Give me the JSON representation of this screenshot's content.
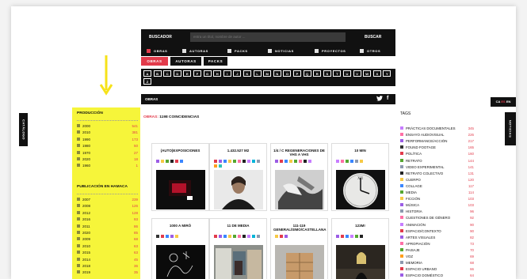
{
  "search": {
    "label": "BUSCADOR",
    "placeholder": "entra un títol, nombre de autor ...",
    "button": "BUSCAR"
  },
  "filters": [
    {
      "label": "OBRAS",
      "active": true
    },
    {
      "label": "AUTORAS",
      "active": false
    },
    {
      "label": "PACKS",
      "active": false
    },
    {
      "label": "NOTICIAS",
      "active": false
    },
    {
      "label": "PROYECTOS",
      "active": false
    },
    {
      "label": "OTROS",
      "active": false
    }
  ],
  "tabs": [
    {
      "label": "OBRAS",
      "active": true
    },
    {
      "label": "AUTORAS",
      "active": false
    },
    {
      "label": "PACKS",
      "active": false
    }
  ],
  "alphabet": [
    "A",
    "B",
    "C",
    "D",
    "E",
    "F",
    "G",
    "H",
    "I",
    "J",
    "K",
    "L",
    "M",
    "N",
    "O",
    "P",
    "Q",
    "R",
    "S",
    "T",
    "U",
    "V",
    "W",
    "X",
    "Y",
    "Z"
  ],
  "section": {
    "title": "OBRAS",
    "twitter_icon": "twitter-icon",
    "facebook_icon": "facebook-icon"
  },
  "results": {
    "prefix": "OBRAS:",
    "text": "1198 COINCIDENCIAS"
  },
  "side": {
    "catalogo": "CATÁLOGO",
    "noticias": "NOTICIAS"
  },
  "languages": {
    "ca": "CA",
    "es": "ES",
    "en": "EN"
  },
  "production": {
    "title": "PRODUCCIÓN",
    "items": [
      {
        "year": "2000",
        "count": "541"
      },
      {
        "year": "2010",
        "count": "381"
      },
      {
        "year": "1990",
        "count": "173"
      },
      {
        "year": "1980",
        "count": "50"
      },
      {
        "year": "1970",
        "count": "27"
      },
      {
        "year": "2020",
        "count": "18"
      },
      {
        "year": "1960",
        "count": "1"
      }
    ]
  },
  "publication": {
    "title": "PUBLICACIÓN EN HAMACA",
    "items": [
      {
        "year": "2007",
        "count": "239"
      },
      {
        "year": "2008",
        "count": "126"
      },
      {
        "year": "2012",
        "count": "128"
      },
      {
        "year": "2016",
        "count": "93"
      },
      {
        "year": "2011",
        "count": "86"
      },
      {
        "year": "2020",
        "count": "85"
      },
      {
        "year": "2009",
        "count": "68"
      },
      {
        "year": "2010",
        "count": "63"
      },
      {
        "year": "2015",
        "count": "63"
      },
      {
        "year": "2014",
        "count": "45"
      },
      {
        "year": "2018",
        "count": "36"
      },
      {
        "year": "2019",
        "count": "35"
      }
    ]
  },
  "cards": [
    {
      "title": "(AUTO)EXPOSICIONES",
      "colors": [
        "#9b5de5",
        "#f6c945",
        "#55a630",
        "#222",
        "#e23b4b",
        "#3a86ff"
      ],
      "thumb": "dark-red"
    },
    {
      "title": "1.432.527 M2",
      "colors": [
        "#e23b4b",
        "#9b5de5",
        "#3a86ff",
        "#f6c945",
        "#55a630",
        "#ff70a6",
        "#222",
        "#c77dff",
        "#00b4d8",
        "#8d99ae",
        "#ff9f1c",
        "#2ec4b6"
      ],
      "thumb": "portrait"
    },
    {
      "title": "1/4 / C REGENERACIONES DE VHS A VHS",
      "colors": [
        "#9b5de5",
        "#e23b4b",
        "#3a86ff",
        "#f6c945",
        "#55a630",
        "#ff70a6",
        "#222",
        "#c77dff"
      ],
      "thumb": "hands"
    },
    {
      "title": "10 MIN",
      "colors": [
        "#c77dff",
        "#ff70a6",
        "#55a630",
        "#3a86ff",
        "#8d99ae",
        "#f6c945"
      ],
      "thumb": "clock"
    },
    {
      "title": "1000 A MIRÓ",
      "colors": [
        "#333",
        "#e23b4b",
        "#3a86ff",
        "#9b5de5",
        "#f6c945"
      ],
      "thumb": "drawing"
    },
    {
      "title": "11 DE MEDIA",
      "colors": [
        "#e23b4b",
        "#9b5de5",
        "#3a86ff",
        "#f6c945",
        "#55a630",
        "#ff70a6",
        "#222",
        "#c77dff",
        "#00b4d8",
        "#8d99ae"
      ],
      "thumb": "room"
    },
    {
      "title": "111-119 GENERALÍSIMO/CASTELLANA",
      "colors": [
        "#f6c945",
        "#e23b4b",
        "#9b5de5"
      ],
      "thumb": "boxes"
    },
    {
      "title": "123M!",
      "colors": [
        "#9b5de5",
        "#e23b4b",
        "#3a86ff",
        "#c77dff",
        "#55a630",
        "#222"
      ],
      "thumb": "figure"
    }
  ],
  "tags": {
    "title": "TAGS",
    "items": [
      {
        "label": "PRÁCTICAS DOCUMENTALES",
        "count": "345",
        "color": "#c77dff"
      },
      {
        "label": "ENSAYO AUDIOVISUAL",
        "count": "226",
        "color": "#ff70a6"
      },
      {
        "label": "PERFORMANCE/ACCIÓN",
        "count": "217",
        "color": "#9b5de5"
      },
      {
        "label": "FOUND FOOTAGE",
        "count": "165",
        "color": "#333333"
      },
      {
        "label": "POLÍTICA",
        "count": "160",
        "color": "#e23b4b"
      },
      {
        "label": "RETRATO",
        "count": "144",
        "color": "#55a630"
      },
      {
        "label": "VIDEO EXPERIMENTAL",
        "count": "141",
        "color": "#8d99ae"
      },
      {
        "label": "RETRATO COLECTIVO",
        "count": "131",
        "color": "#222222"
      },
      {
        "label": "CUERPO",
        "count": "120",
        "color": "#f6c945"
      },
      {
        "label": "COLLAGE",
        "count": "117",
        "color": "#3a86ff"
      },
      {
        "label": "MEDIA",
        "count": "114",
        "color": "#55a630"
      },
      {
        "label": "FICCIÓN",
        "count": "103",
        "color": "#f6c945"
      },
      {
        "label": "MÚSICA",
        "count": "103",
        "color": "#9b5de5"
      },
      {
        "label": "HISTORIA",
        "count": "96",
        "color": "#8d99ae"
      },
      {
        "label": "CUESTIONES DE GÉNERO",
        "count": "92",
        "color": "#ff70a6"
      },
      {
        "label": "ANIMACIÓN",
        "count": "90",
        "color": "#c77dff"
      },
      {
        "label": "ESPACIO/CONTEXTO",
        "count": "90",
        "color": "#e23b4b"
      },
      {
        "label": "ARTES VISUALES",
        "count": "82",
        "color": "#9b5de5"
      },
      {
        "label": "APROPIACIÓN",
        "count": "73",
        "color": "#ff70a6"
      },
      {
        "label": "PAISAJE",
        "count": "70",
        "color": "#55a630"
      },
      {
        "label": "VOZ",
        "count": "69",
        "color": "#ff9f1c"
      },
      {
        "label": "MEMORIA",
        "count": "68",
        "color": "#8d99ae"
      },
      {
        "label": "ESPACIO URBANO",
        "count": "66",
        "color": "#e23b4b"
      },
      {
        "label": "ESPACIO DOMÉSTICO",
        "count": "64",
        "color": "#9b5de5"
      }
    ]
  },
  "colors": {
    "accent": "#e23b4b",
    "panel": "#f6f53a",
    "bar": "#111111"
  }
}
